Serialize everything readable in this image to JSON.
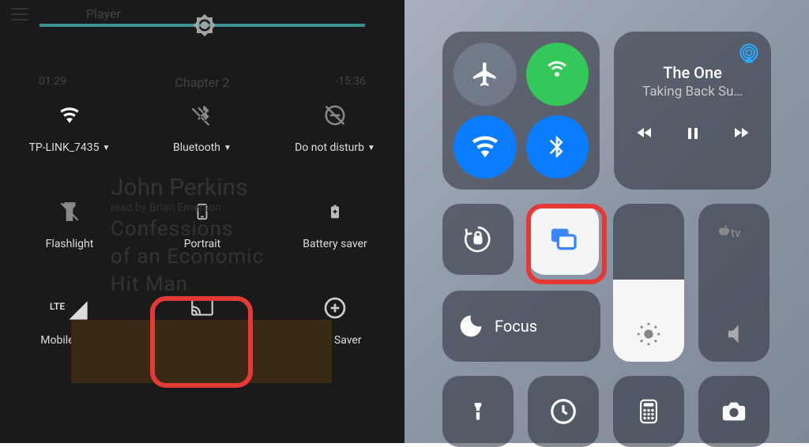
{
  "android": {
    "header": {
      "player_label": "Player",
      "time_left": "01:29",
      "time_right": "-15:36",
      "chapter": "Chapter 2"
    },
    "background": {
      "author": "John Perkins",
      "line1": "read by Brian Emerson",
      "line2": "Confessions",
      "line3": "of an Economic",
      "line4": "Hit Man"
    },
    "row1": {
      "wifi": {
        "label": "TP-LINK_7435"
      },
      "bluetooth": {
        "label": "Bluetooth"
      },
      "dnd": {
        "label": "Do not disturb"
      }
    },
    "row2": {
      "flashlight": {
        "label": "Flashlight"
      },
      "portrait": {
        "label": "Portrait"
      },
      "battery": {
        "label": "Battery saver"
      }
    },
    "row3": {
      "mobile_data": {
        "label": "Mobile data",
        "badge": "LTE"
      },
      "cast": {
        "label": "Cast"
      },
      "data_saver": {
        "label": "Data Saver"
      }
    }
  },
  "ios": {
    "music": {
      "title": "The One",
      "artist": "Taking Back Su…"
    },
    "focus": {
      "label": "Focus"
    },
    "brightness_pct": 52,
    "volume_pct": 0,
    "apple_tv": {
      "label": "tv"
    }
  }
}
